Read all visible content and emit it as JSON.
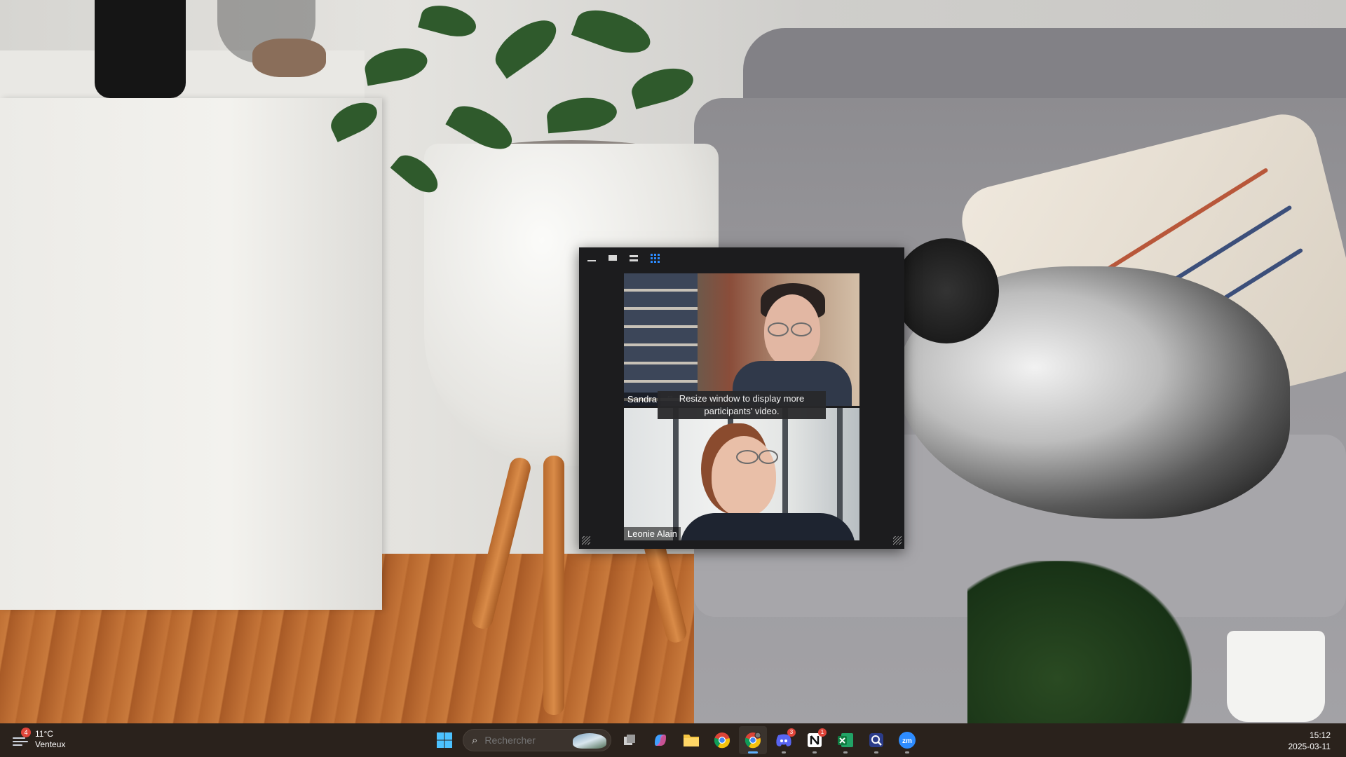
{
  "zoom_window": {
    "toolbar": {
      "minimize_label": "",
      "view_single_label": "",
      "view_strip_label": "",
      "view_grid_label": ""
    },
    "participants": [
      {
        "name": "Sandra"
      },
      {
        "name": "Leonie Alain"
      }
    ],
    "tooltip": "Resize window to display more participants' video.",
    "accent_color": "#2d8cff"
  },
  "taskbar": {
    "weather": {
      "temperature": "11°C",
      "condition": "Venteux",
      "badge": "4"
    },
    "search": {
      "placeholder": "Rechercher"
    },
    "apps": [
      {
        "name": "windows-start",
        "running": false
      },
      {
        "name": "task-view",
        "running": false
      },
      {
        "name": "copilot",
        "running": false
      },
      {
        "name": "file-explorer",
        "running": false
      },
      {
        "name": "chrome",
        "running": false
      },
      {
        "name": "chrome-profile",
        "running": true,
        "active": true
      },
      {
        "name": "discord",
        "running": true,
        "badge": "3"
      },
      {
        "name": "notion",
        "running": true,
        "badge": "1"
      },
      {
        "name": "excel",
        "running": true
      },
      {
        "name": "magnifier-app",
        "running": true
      },
      {
        "name": "zoom",
        "running": true
      }
    ],
    "clock": {
      "time": "15:12",
      "date": "2025-03-11"
    }
  }
}
